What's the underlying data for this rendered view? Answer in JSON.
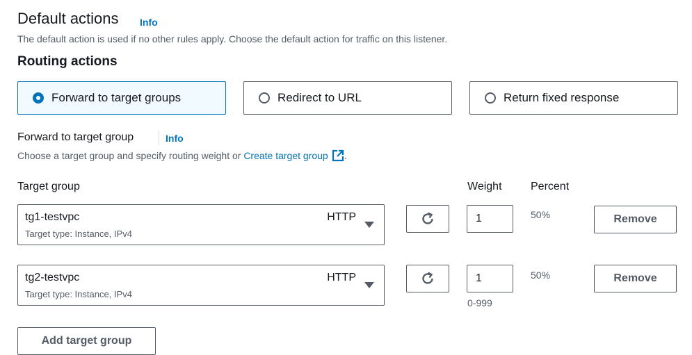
{
  "default_actions": {
    "title": "Default actions",
    "info": "Info",
    "description": "The default action is used if no other rules apply. Choose the default action for traffic on this listener."
  },
  "routing_actions": {
    "title": "Routing actions",
    "options": [
      {
        "label": "Forward to target groups",
        "selected": true
      },
      {
        "label": "Redirect to URL",
        "selected": false
      },
      {
        "label": "Return fixed response",
        "selected": false
      }
    ]
  },
  "forward": {
    "label": "Forward to target group",
    "info": "Info",
    "description_prefix": "Choose a target group and specify routing weight or",
    "create_link": "Create target group",
    "description_suffix": "."
  },
  "columns": {
    "target_group": "Target group",
    "weight": "Weight",
    "percent": "Percent"
  },
  "target_groups": [
    {
      "name": "tg1-testvpc",
      "meta": "Target type: Instance, IPv4",
      "protocol": "HTTP",
      "weight": "1",
      "percent": "50%",
      "remove_label": "Remove"
    },
    {
      "name": "tg2-testvpc",
      "meta": "Target type: Instance, IPv4",
      "protocol": "HTTP",
      "weight": "1",
      "percent": "50%",
      "remove_label": "Remove"
    }
  ],
  "weight_hint": "0-999",
  "add_button": "Add target group",
  "colors": {
    "accent": "#0073bb",
    "text": "#16191f",
    "muted": "#545b64"
  }
}
